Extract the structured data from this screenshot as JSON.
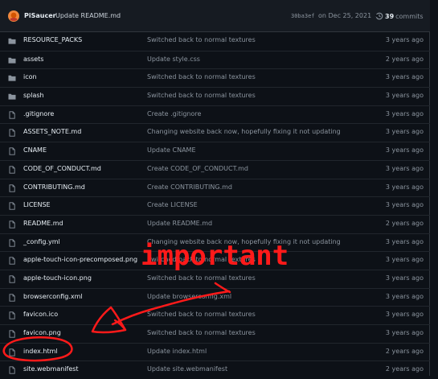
{
  "commit": {
    "author": "PiSaucer",
    "message": "Update README.md",
    "sha": "30ba3ef",
    "date": "on Dec 25, 2021",
    "count": "39",
    "count_label": "commits"
  },
  "files": [
    {
      "type": "folder",
      "name": "RESOURCE_PACKS",
      "message": "Switched back to normal textures",
      "age": "3 years ago"
    },
    {
      "type": "folder",
      "name": "assets",
      "message": "Update style.css",
      "age": "2 years ago"
    },
    {
      "type": "folder",
      "name": "icon",
      "message": "Switched back to normal textures",
      "age": "3 years ago"
    },
    {
      "type": "folder",
      "name": "splash",
      "message": "Switched back to normal textures",
      "age": "3 years ago"
    },
    {
      "type": "file",
      "name": ".gitignore",
      "message": "Create .gitignore",
      "age": "3 years ago"
    },
    {
      "type": "file",
      "name": "ASSETS_NOTE.md",
      "message": "Changing website back now, hopefully fixing it not updating",
      "age": "3 years ago"
    },
    {
      "type": "file",
      "name": "CNAME",
      "message": "Update CNAME",
      "age": "3 years ago"
    },
    {
      "type": "file",
      "name": "CODE_OF_CONDUCT.md",
      "message": "Create CODE_OF_CONDUCT.md",
      "age": "3 years ago"
    },
    {
      "type": "file",
      "name": "CONTRIBUTING.md",
      "message": "Create CONTRIBUTING.md",
      "age": "3 years ago"
    },
    {
      "type": "file",
      "name": "LICENSE",
      "message": "Create LICENSE",
      "age": "3 years ago"
    },
    {
      "type": "file",
      "name": "README.md",
      "message": "Update README.md",
      "age": "2 years ago"
    },
    {
      "type": "file",
      "name": "_config.yml",
      "message": "Changing website back now, hopefully fixing it not updating",
      "age": "3 years ago"
    },
    {
      "type": "file",
      "name": "apple-touch-icon-precomposed.png",
      "message": "Switched back to normal textures",
      "age": "3 years ago"
    },
    {
      "type": "file",
      "name": "apple-touch-icon.png",
      "message": "Switched back to normal textures",
      "age": "3 years ago"
    },
    {
      "type": "file",
      "name": "browserconfig.xml",
      "message": "Update browserconfig.xml",
      "age": "3 years ago"
    },
    {
      "type": "file",
      "name": "favicon.ico",
      "message": "Switched back to normal textures",
      "age": "3 years ago"
    },
    {
      "type": "file",
      "name": "favicon.png",
      "message": "Switched back to normal textures",
      "age": "3 years ago"
    },
    {
      "type": "file",
      "name": "index.html",
      "message": "Update index.html",
      "age": "2 years ago"
    },
    {
      "type": "file",
      "name": "site.webmanifest",
      "message": "Update site.webmanifest",
      "age": "2 years ago"
    }
  ],
  "annotation": {
    "text": "important",
    "color": "#ff1a1a"
  },
  "colors": {
    "background": "#0d1117",
    "header_bg": "#161b22",
    "border": "#30363d",
    "muted": "#8b949e",
    "text": "#e6edf3",
    "icon": "#8b949e"
  }
}
